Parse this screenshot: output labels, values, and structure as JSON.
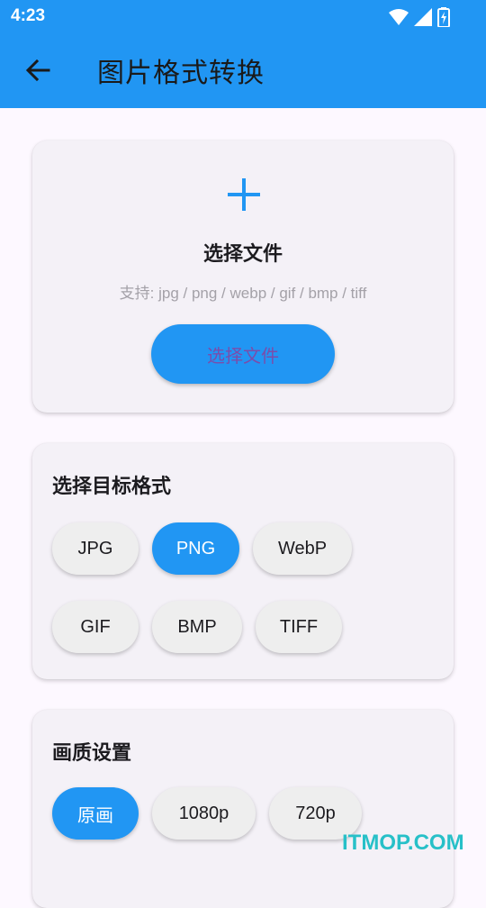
{
  "status_bar": {
    "time": "4:23",
    "icons": [
      "wifi-icon",
      "signal-icon",
      "battery-charging-icon"
    ]
  },
  "app_bar": {
    "back_icon": "arrow-left-icon",
    "title": "图片格式转换",
    "color": "#2196f3"
  },
  "upload_card": {
    "icon": "plus-icon",
    "title": "选择文件",
    "supported": "支持: jpg / png / webp / gif / bmp / tiff",
    "button_label": "选择文件"
  },
  "format_card": {
    "title": "选择目标格式",
    "options": [
      {
        "label": "JPG",
        "selected": false
      },
      {
        "label": "PNG",
        "selected": true
      },
      {
        "label": "WebP",
        "selected": false
      },
      {
        "label": "GIF",
        "selected": false
      },
      {
        "label": "BMP",
        "selected": false
      },
      {
        "label": "TIFF",
        "selected": false
      }
    ]
  },
  "quality_card": {
    "title": "画质设置",
    "options": [
      {
        "label": "原画",
        "selected": true
      },
      {
        "label": "1080p",
        "selected": false
      },
      {
        "label": "720p",
        "selected": false
      }
    ]
  },
  "watermark": "ITMOP.COM",
  "colors": {
    "accent": "#2196f3",
    "chip_bg": "#eeeeee",
    "card_bg": "#f4f1f7",
    "button_text": "#7a4dab"
  }
}
